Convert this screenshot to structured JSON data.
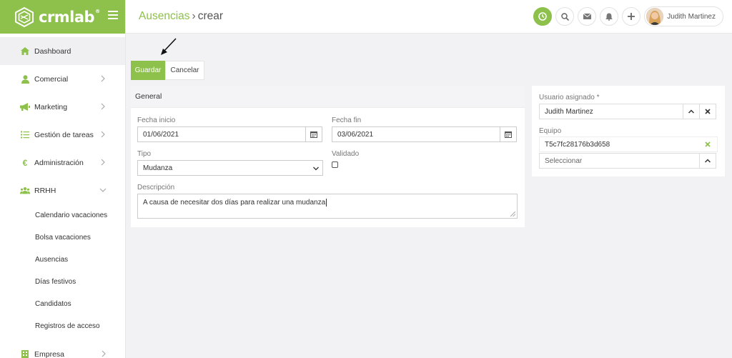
{
  "brand": {
    "name": "crmlab",
    "reg": "®"
  },
  "sidebar": {
    "items": [
      {
        "label": "Dashboard",
        "icon": "home-icon"
      },
      {
        "label": "Comercial",
        "icon": "user-icon"
      },
      {
        "label": "Marketing",
        "icon": "megaphone-icon"
      },
      {
        "label": "Gestión de tareas",
        "icon": "tasks-icon"
      },
      {
        "label": "Administración",
        "icon": "euro-icon"
      },
      {
        "label": "RRHH",
        "icon": "users-icon"
      }
    ],
    "submenu": [
      "Calendario vacaciones",
      "Bolsa vacaciones",
      "Ausencias",
      "Días festivos",
      "Candidatos",
      "Registros de acceso"
    ],
    "last_item": {
      "label": "Empresa",
      "icon": "building-icon"
    }
  },
  "header": {
    "crumb1": "Ausencias",
    "separator": "›",
    "crumb2": "crear",
    "user_name": "Judith Martinez"
  },
  "toolbar": {
    "save_label": "Guardar",
    "cancel_label": "Cancelar"
  },
  "general": {
    "title": "General",
    "fecha_inicio_label": "Fecha inicio",
    "fecha_inicio_value": "01/06/2021",
    "fecha_fin_label": "Fecha fin",
    "fecha_fin_value": "03/06/2021",
    "tipo_label": "Tipo",
    "tipo_value": "Mudanza",
    "validado_label": "Validado",
    "descripcion_label": "Descripción",
    "descripcion_value": "A causa de necesitar dos días para realizar una mudanza"
  },
  "assign": {
    "usuario_label": "Usuario asignado *",
    "usuario_value": "Judith Martinez",
    "equipo_label": "Equipo",
    "equipo_tag": "T5c7fc28176b3d658",
    "equipo_placeholder": "Seleccionar"
  },
  "colors": {
    "accent": "#8dc14b",
    "sidebar_bg": "#ffffff",
    "page_bg": "#f2f2f4"
  }
}
